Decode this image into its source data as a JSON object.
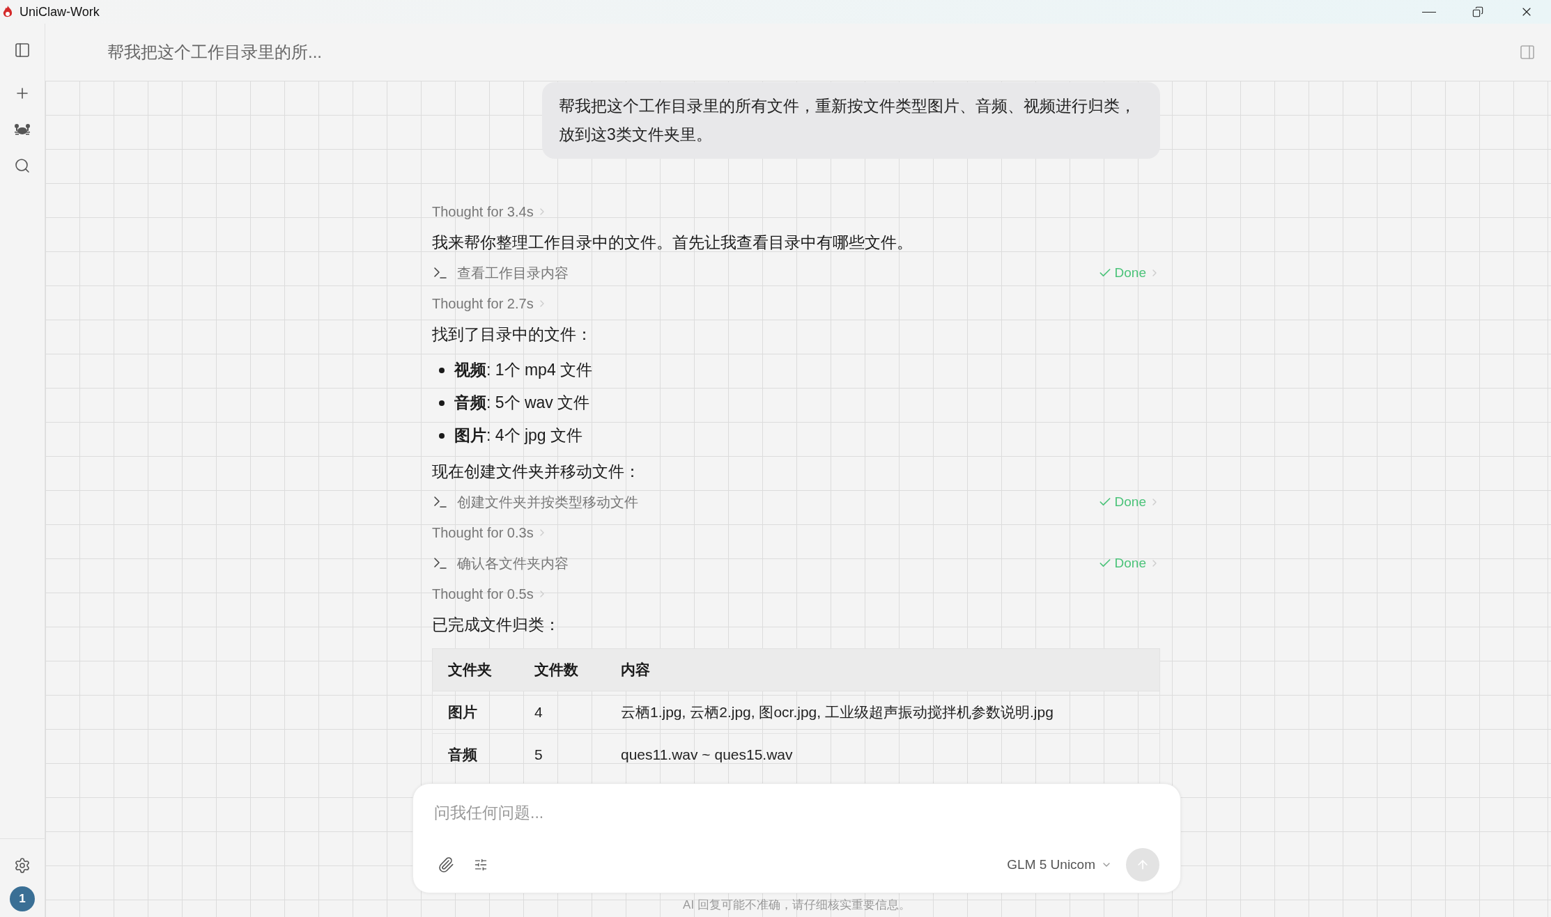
{
  "window": {
    "title": "UniClaw-Work"
  },
  "header": {
    "title": "帮我把这个工作目录里的所..."
  },
  "sidebar": {
    "avatar": "1"
  },
  "messages": [
    {
      "kind": "user",
      "text": "帮我把这个工作目录里的所有文件，重新按文件类型图片、音频、视频进行归类，放到这3类文件夹里。"
    },
    {
      "kind": "thought",
      "text": "Thought for 3.4s"
    },
    {
      "kind": "text",
      "text": "我来帮你整理工作目录中的文件。首先让我查看目录中有哪些文件。"
    },
    {
      "kind": "tool",
      "text": "查看工作目录内容",
      "status": "Done"
    },
    {
      "kind": "thought",
      "text": "Thought for 2.7s"
    },
    {
      "kind": "text",
      "text": "找到了目录中的文件："
    },
    {
      "kind": "bullets",
      "items": [
        "**视频**: 1个 mp4 文件",
        "**音频**: 5个 wav 文件",
        "**图片**: 4个 jpg 文件"
      ]
    },
    {
      "kind": "text",
      "text": "现在创建文件夹并移动文件："
    },
    {
      "kind": "tool",
      "text": "创建文件夹并按类型移动文件",
      "status": "Done"
    },
    {
      "kind": "thought",
      "text": "Thought for 0.3s"
    },
    {
      "kind": "tool",
      "text": "确认各文件夹内容",
      "status": "Done"
    },
    {
      "kind": "thought",
      "text": "Thought for 0.5s"
    },
    {
      "kind": "text",
      "text": "已完成文件归类："
    },
    {
      "kind": "table",
      "columns": [
        "文件夹",
        "文件数",
        "内容"
      ],
      "rows": [
        [
          "图片",
          "4",
          "云栖1.jpg, 云栖2.jpg, 图ocr.jpg, 工业级超声振动搅拌机参数说明.jpg"
        ],
        [
          "音频",
          "5",
          "ques11.wav ~ ques15.wav"
        ]
      ]
    }
  ],
  "composer": {
    "placeholder": "问我任何问题...",
    "model": "GLM 5 Unicom"
  },
  "disclaimer": "AI 回复可能不准确，请仔细核实重要信息。"
}
